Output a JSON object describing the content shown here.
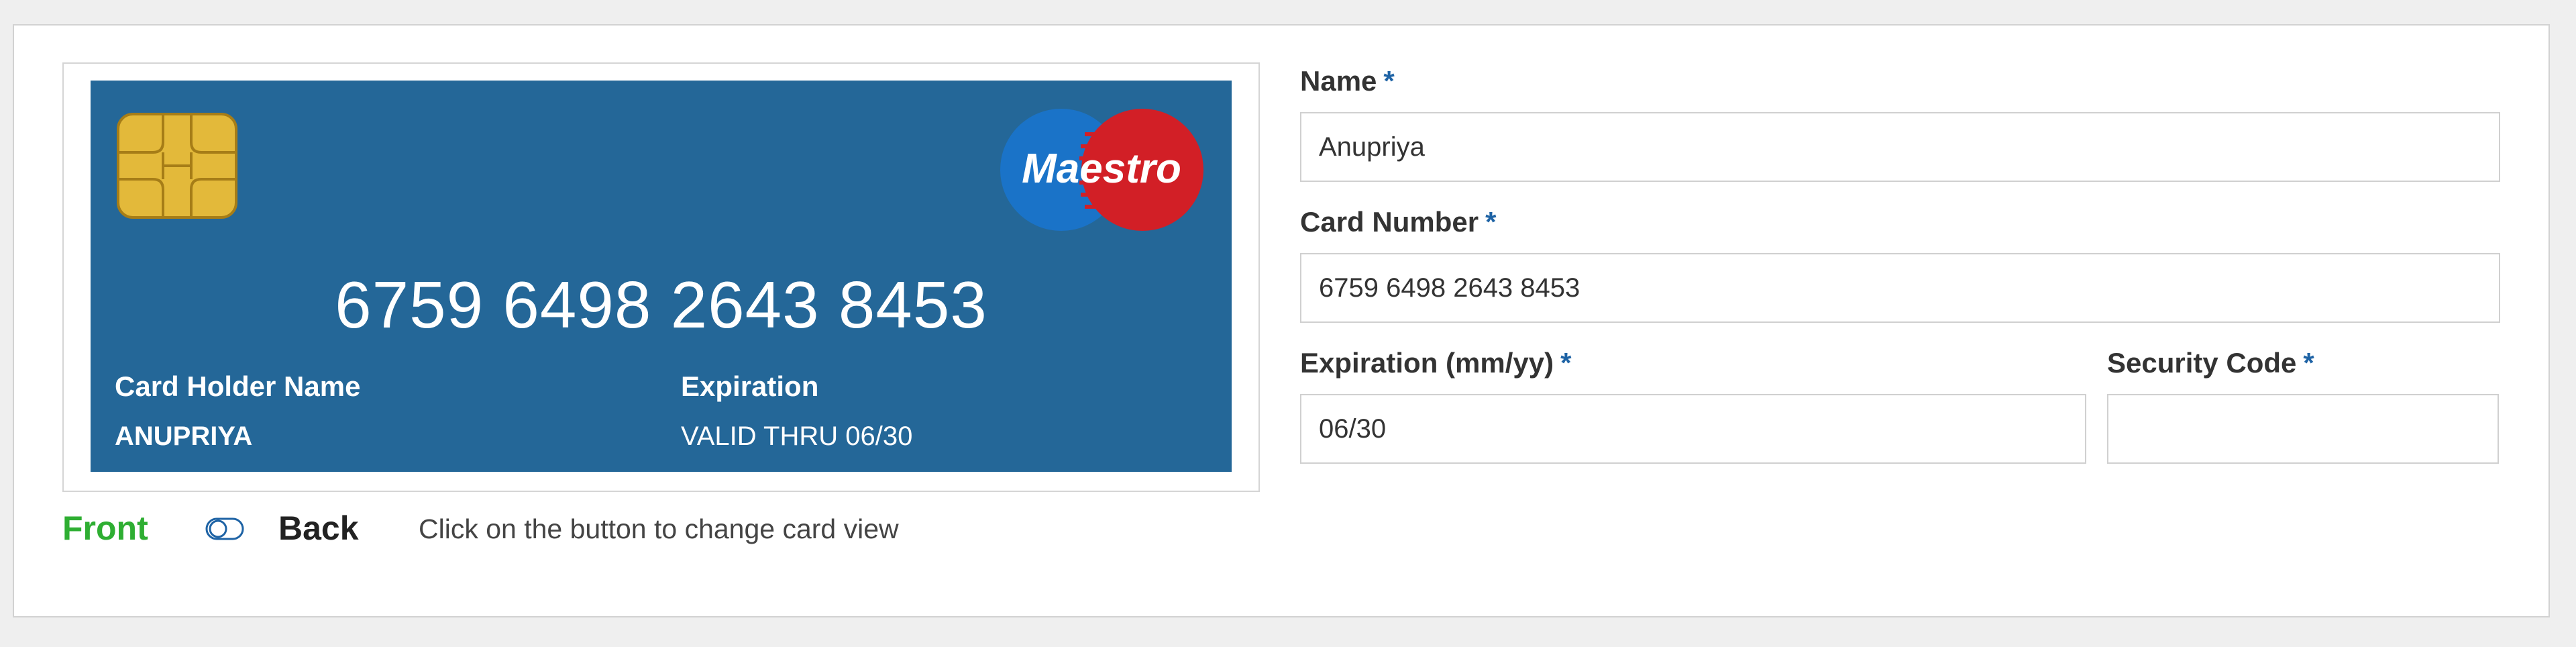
{
  "card": {
    "number": "6759 6498 2643 8453",
    "holder_label": "Card Holder Name",
    "holder_value": "ANUPRIYA",
    "expiration_label": "Expiration",
    "expiration_value": "VALID THRU 06/30",
    "brand": "Maestro",
    "background_color": "#246798"
  },
  "view_toggle": {
    "front_label": "Front",
    "back_label": "Back",
    "hint": "Click on the button to change card view",
    "active": "front",
    "front_color": "#2eae32",
    "icon": "toggle-icon"
  },
  "form": {
    "required_marker": "*",
    "name": {
      "label": "Name",
      "value": "Anupriya"
    },
    "card_number": {
      "label": "Card Number",
      "value": "6759 6498 2643 8453"
    },
    "expiration": {
      "label": "Expiration (mm/yy)",
      "value": "06/30"
    },
    "security_code": {
      "label": "Security Code",
      "value": ""
    }
  },
  "colors": {
    "required": "#1e63a5",
    "maestro_blue": "#1a73c8",
    "maestro_red": "#d21f26"
  }
}
